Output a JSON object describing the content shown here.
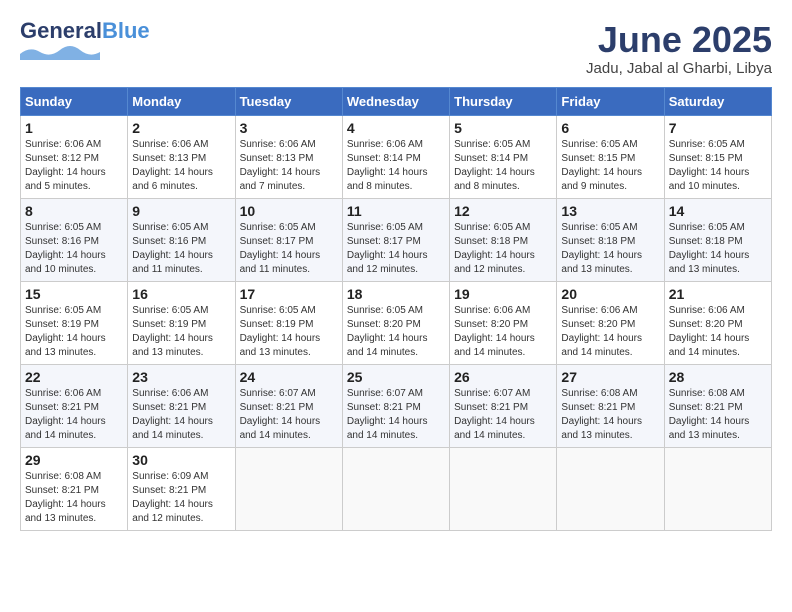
{
  "logo": {
    "line1": "General",
    "line2": "Blue",
    "tagline": ""
  },
  "header": {
    "title": "June 2025",
    "subtitle": "Jadu, Jabal al Gharbi, Libya"
  },
  "weekdays": [
    "Sunday",
    "Monday",
    "Tuesday",
    "Wednesday",
    "Thursday",
    "Friday",
    "Saturday"
  ],
  "weeks": [
    [
      {
        "day": "1",
        "sunrise": "6:06 AM",
        "sunset": "8:12 PM",
        "daylight": "14 hours and 5 minutes."
      },
      {
        "day": "2",
        "sunrise": "6:06 AM",
        "sunset": "8:13 PM",
        "daylight": "14 hours and 6 minutes."
      },
      {
        "day": "3",
        "sunrise": "6:06 AM",
        "sunset": "8:13 PM",
        "daylight": "14 hours and 7 minutes."
      },
      {
        "day": "4",
        "sunrise": "6:06 AM",
        "sunset": "8:14 PM",
        "daylight": "14 hours and 8 minutes."
      },
      {
        "day": "5",
        "sunrise": "6:05 AM",
        "sunset": "8:14 PM",
        "daylight": "14 hours and 8 minutes."
      },
      {
        "day": "6",
        "sunrise": "6:05 AM",
        "sunset": "8:15 PM",
        "daylight": "14 hours and 9 minutes."
      },
      {
        "day": "7",
        "sunrise": "6:05 AM",
        "sunset": "8:15 PM",
        "daylight": "14 hours and 10 minutes."
      }
    ],
    [
      {
        "day": "8",
        "sunrise": "6:05 AM",
        "sunset": "8:16 PM",
        "daylight": "14 hours and 10 minutes."
      },
      {
        "day": "9",
        "sunrise": "6:05 AM",
        "sunset": "8:16 PM",
        "daylight": "14 hours and 11 minutes."
      },
      {
        "day": "10",
        "sunrise": "6:05 AM",
        "sunset": "8:17 PM",
        "daylight": "14 hours and 11 minutes."
      },
      {
        "day": "11",
        "sunrise": "6:05 AM",
        "sunset": "8:17 PM",
        "daylight": "14 hours and 12 minutes."
      },
      {
        "day": "12",
        "sunrise": "6:05 AM",
        "sunset": "8:18 PM",
        "daylight": "14 hours and 12 minutes."
      },
      {
        "day": "13",
        "sunrise": "6:05 AM",
        "sunset": "8:18 PM",
        "daylight": "14 hours and 13 minutes."
      },
      {
        "day": "14",
        "sunrise": "6:05 AM",
        "sunset": "8:18 PM",
        "daylight": "14 hours and 13 minutes."
      }
    ],
    [
      {
        "day": "15",
        "sunrise": "6:05 AM",
        "sunset": "8:19 PM",
        "daylight": "14 hours and 13 minutes."
      },
      {
        "day": "16",
        "sunrise": "6:05 AM",
        "sunset": "8:19 PM",
        "daylight": "14 hours and 13 minutes."
      },
      {
        "day": "17",
        "sunrise": "6:05 AM",
        "sunset": "8:19 PM",
        "daylight": "14 hours and 13 minutes."
      },
      {
        "day": "18",
        "sunrise": "6:05 AM",
        "sunset": "8:20 PM",
        "daylight": "14 hours and 14 minutes."
      },
      {
        "day": "19",
        "sunrise": "6:06 AM",
        "sunset": "8:20 PM",
        "daylight": "14 hours and 14 minutes."
      },
      {
        "day": "20",
        "sunrise": "6:06 AM",
        "sunset": "8:20 PM",
        "daylight": "14 hours and 14 minutes."
      },
      {
        "day": "21",
        "sunrise": "6:06 AM",
        "sunset": "8:20 PM",
        "daylight": "14 hours and 14 minutes."
      }
    ],
    [
      {
        "day": "22",
        "sunrise": "6:06 AM",
        "sunset": "8:21 PM",
        "daylight": "14 hours and 14 minutes."
      },
      {
        "day": "23",
        "sunrise": "6:06 AM",
        "sunset": "8:21 PM",
        "daylight": "14 hours and 14 minutes."
      },
      {
        "day": "24",
        "sunrise": "6:07 AM",
        "sunset": "8:21 PM",
        "daylight": "14 hours and 14 minutes."
      },
      {
        "day": "25",
        "sunrise": "6:07 AM",
        "sunset": "8:21 PM",
        "daylight": "14 hours and 14 minutes."
      },
      {
        "day": "26",
        "sunrise": "6:07 AM",
        "sunset": "8:21 PM",
        "daylight": "14 hours and 14 minutes."
      },
      {
        "day": "27",
        "sunrise": "6:08 AM",
        "sunset": "8:21 PM",
        "daylight": "14 hours and 13 minutes."
      },
      {
        "day": "28",
        "sunrise": "6:08 AM",
        "sunset": "8:21 PM",
        "daylight": "14 hours and 13 minutes."
      }
    ],
    [
      {
        "day": "29",
        "sunrise": "6:08 AM",
        "sunset": "8:21 PM",
        "daylight": "14 hours and 13 minutes."
      },
      {
        "day": "30",
        "sunrise": "6:09 AM",
        "sunset": "8:21 PM",
        "daylight": "14 hours and 12 minutes."
      },
      null,
      null,
      null,
      null,
      null
    ]
  ]
}
